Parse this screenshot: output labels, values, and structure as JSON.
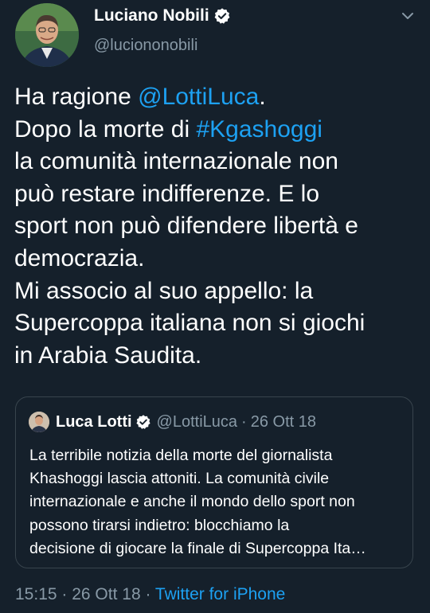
{
  "author": {
    "name": "Luciano Nobili",
    "handle": "@luciononobili"
  },
  "tweet": {
    "mention": "@LottiLuca",
    "hashtag": "#Kgashoggi",
    "line1_prefix": "Ha ragione ",
    "line1_suffix": ".",
    "line2_prefix": "Dopo la morte di ",
    "line3": "la comunità internazionale non",
    "line4": "può restare indifferenze. E lo",
    "line5": "sport non può difendere libertà e",
    "line6": "democrazia.",
    "line7": "Mi associo al suo appello: la",
    "line8": "Supercoppa italiana non si giochi",
    "line9": "in Arabia Saudita."
  },
  "quoted_tweet": {
    "name": "Luca Lotti",
    "handle": "@LottiLuca",
    "separator": "·",
    "date": "26 Ott 18",
    "lines": [
      "La terribile notizia della morte del giornalista",
      "Khashoggi lascia attoniti. La comunità civile",
      "internazionale e anche il mondo dello sport non",
      "possono tirarsi indietro: blocchiamo la",
      "decisione di giocare la finale di Supercoppa Ita…"
    ]
  },
  "meta": {
    "time": "15:15",
    "separator1": " · ",
    "date": "26 Ott 18",
    "separator2": " · ",
    "source": "Twitter for iPhone"
  },
  "icons": {
    "verified": "verified-badge-icon",
    "caret": "chevron-down-icon"
  },
  "colors": {
    "background": "#15202b",
    "link": "#1da1f2",
    "secondary_text": "#8899a6",
    "border": "#38444d"
  }
}
